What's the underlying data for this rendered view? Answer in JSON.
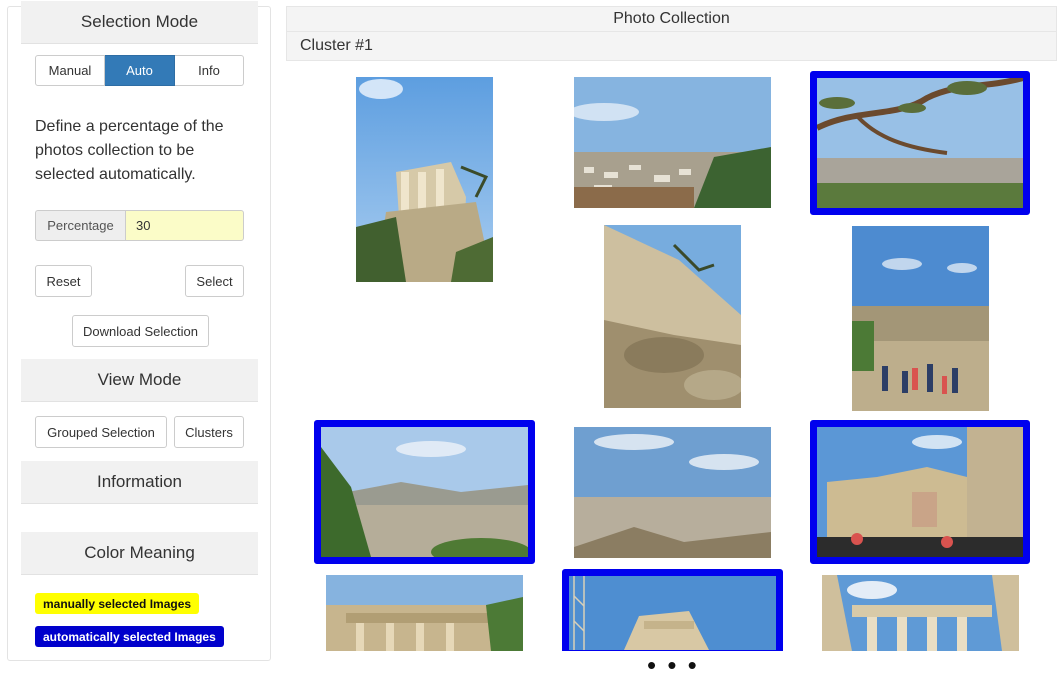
{
  "sidebar": {
    "selection_mode": {
      "title": "Selection Mode",
      "tabs": [
        "Manual",
        "Auto",
        "Info"
      ],
      "active_tab": "Auto",
      "description": "Define a percentage of the photos collection to be selected automatically.",
      "percentage_label": "Percentage",
      "percentage_value": "30",
      "reset_label": "Reset",
      "select_label": "Select",
      "download_label": "Download Selection"
    },
    "view_mode": {
      "title": "View Mode",
      "grouped_label": "Grouped Selection",
      "clusters_label": "Clusters"
    },
    "information": {
      "title": "Information"
    },
    "color_meaning": {
      "title": "Color Meaning",
      "manual_label": "manually selected Images",
      "manual_color": "#ffff00",
      "auto_label": "automatically selected Images",
      "auto_color": "#0000cc"
    }
  },
  "main": {
    "title": "Photo Collection",
    "cluster_label": "Cluster #1",
    "selection_border_color": "#0000ee",
    "photos": [
      {
        "name": "temple-athena-nike",
        "selected": false
      },
      {
        "name": "city-panorama-odeon",
        "selected": false
      },
      {
        "name": "olive-branch-city-view",
        "selected": true
      },
      {
        "name": "fortification-wall",
        "selected": false
      },
      {
        "name": "tourists-propylaea",
        "selected": false
      },
      {
        "name": "athens-hills-view",
        "selected": true
      },
      {
        "name": "athens-cityscape",
        "selected": false
      },
      {
        "name": "propylaea-visitors",
        "selected": true
      },
      {
        "name": "ruins-partial",
        "selected": false
      },
      {
        "name": "temple-top-partial",
        "selected": true
      },
      {
        "name": "erechtheion-partial",
        "selected": false
      }
    ],
    "more_indicator": "• • •"
  }
}
